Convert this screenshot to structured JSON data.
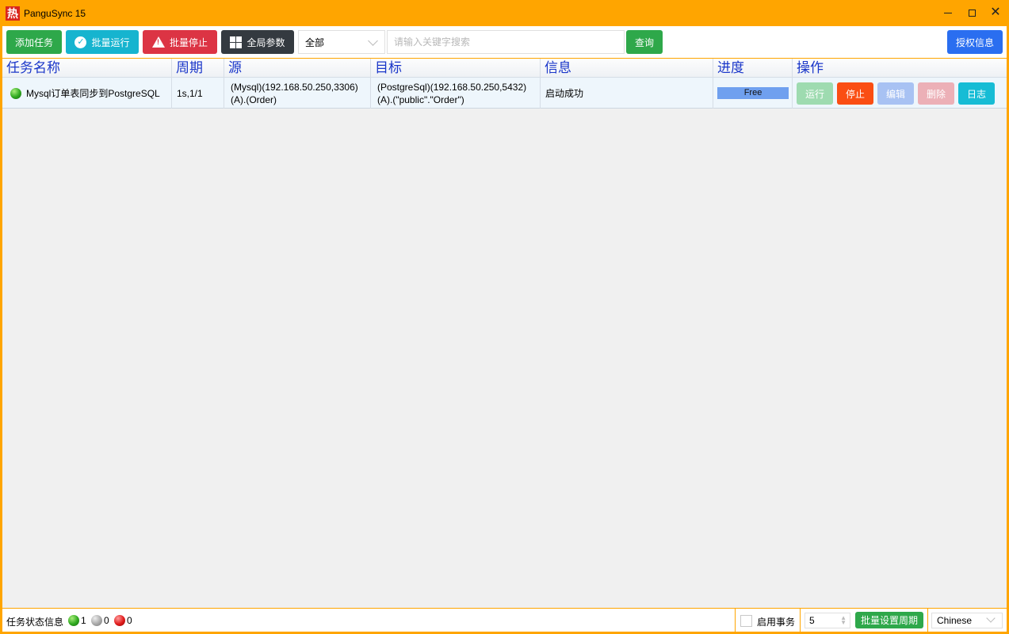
{
  "window": {
    "app_icon_glyph": "热",
    "title": "PanguSync 15",
    "controls": {
      "minimize": "minimize",
      "maximize": "maximize",
      "close": "✕"
    }
  },
  "toolbar": {
    "add_task": "添加任务",
    "batch_run": "批量运行",
    "batch_stop": "批量停止",
    "global_params": "全局参数",
    "filter_selected": "全部",
    "search_placeholder": "请输入关键字搜索",
    "search_value": "",
    "query": "查询",
    "license": "授权信息"
  },
  "table": {
    "headers": [
      "任务名称",
      "周期",
      "源",
      "目标",
      "信息",
      "进度",
      "操作"
    ],
    "rows": [
      {
        "status": "running-green",
        "name": "Mysql订单表同步到PostgreSQL",
        "cycle": "1s,1/1",
        "source_line1": "(Mysql)(192.168.50.250,3306)",
        "source_line2": "(A).(Order)",
        "target_line1": "(PostgreSql)(192.168.50.250,5432)",
        "target_line2": "(A).(\"public\".\"Order\")",
        "info": "启动成功",
        "progress_label": "Free",
        "progress_fraction": 1.0,
        "actions": {
          "run": "运行",
          "stop": "停止",
          "edit": "编辑",
          "delete": "删除",
          "log": "日志"
        }
      }
    ]
  },
  "statusbar": {
    "label": "任务状态信息",
    "green_count": "1",
    "gray_count": "0",
    "red_count": "0",
    "transaction_label": "启用事务",
    "transaction_checked": false,
    "period_value": "5",
    "batch_period": "批量设置周期",
    "language": "Chinese"
  },
  "colors": {
    "frame": "#ffa500",
    "header_text": "#1a36c9",
    "green": "#2ea84a",
    "cyan": "#16b4cf",
    "red": "#dc3444",
    "dark": "#343a40",
    "blue": "#2a6ef0",
    "orange_stop": "#fa4e13"
  }
}
